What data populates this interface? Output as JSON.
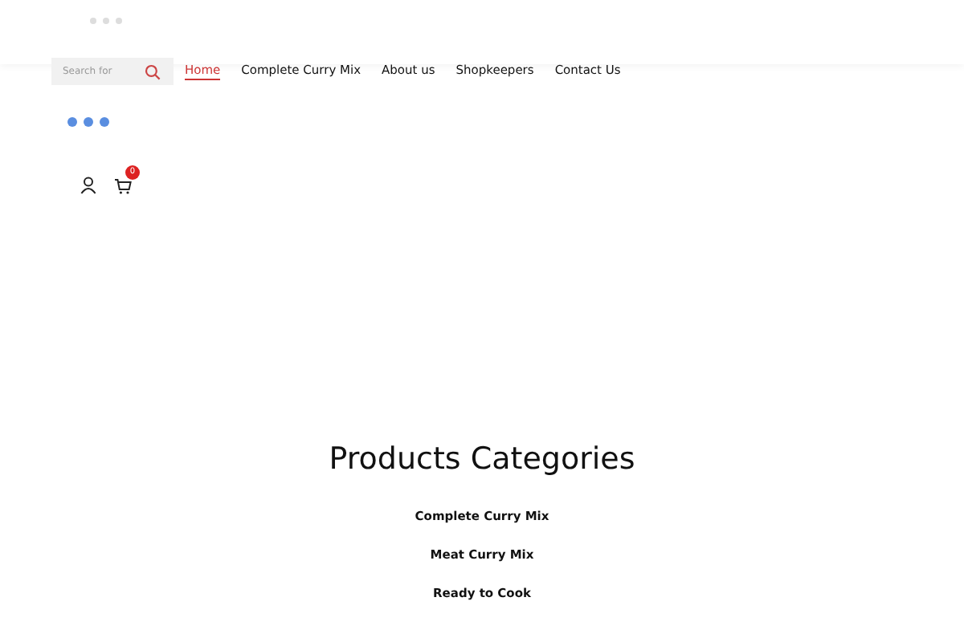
{
  "search": {
    "placeholder": "Search for"
  },
  "nav": [
    {
      "label": "Home",
      "selected": true
    },
    {
      "label": "Complete Curry Mix",
      "selected": false
    },
    {
      "label": "About us",
      "selected": false
    },
    {
      "label": "Shopkeepers",
      "selected": false
    },
    {
      "label": "Contact Us",
      "selected": false
    }
  ],
  "cart": {
    "count": "0"
  },
  "categories": {
    "title": "Products Categories",
    "items": [
      "Complete Curry Mix",
      "Meat Curry Mix",
      "Ready to Cook"
    ]
  }
}
